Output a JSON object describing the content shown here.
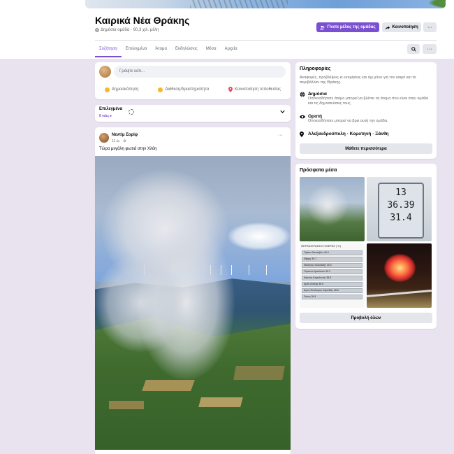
{
  "group": {
    "title": "Καιρικά Νέα Θράκης",
    "meta": "Δημόσια ομάδα · 60,3 χιλ. μέλη",
    "join_label": "Γίνετε μέλος της ομάδας",
    "share_label": "Κοινοποίηση",
    "more_label": "···"
  },
  "tabs": [
    "Συζήτηση",
    "Επιλεγμένα",
    "Άτομα",
    "Εκδηλώσεις",
    "Μέσα",
    "Αρχεία"
  ],
  "composer": {
    "placeholder": "Γράψτε κάτι...",
    "actions": [
      "Δημοσκόπηση",
      "Διάθεση/δραστηριότητα",
      "Κοινοποίηση τοποθεσίας"
    ]
  },
  "filter": {
    "label": "Επιλεγμένα",
    "sub": "6 νέες ▸"
  },
  "post": {
    "author": "Νεντίμ Σορίφ",
    "time": "11 ώ. · ⚙",
    "text": "Τώρα μεγάλη φωτιά στην Χλόη",
    "more": "···"
  },
  "info": {
    "heading": "Πληροφορίες",
    "description": "Αναφορές, προβλέψεις κι εκτιμήσεις και όχι μόνο για τον καιρό και το περιβάλλον της Θράκης.",
    "public_title": "Δημόσια",
    "public_desc": "Οποιοσδήποτε άτομο μπορεί να βλέπει τα άτομα που είναι στην ομάδα και τις δημοσιεύσεις τους.",
    "visible_title": "Ορατή",
    "visible_desc": "Οποιοσδήποτε μπορεί να βρει αυτή την ομάδα.",
    "location": "Αλεξανδρούπολη · Κομοτηνή · Ξάνθη",
    "learn_more": "Μάθετε περισσότερα"
  },
  "media": {
    "heading": "Πρόσφατα μέσα",
    "see_all": "Προβολή όλων",
    "thermometer_lines": [
      "13",
      "36.39",
      "31.4"
    ],
    "table_title": "ΘΕΡΜΟΚΡΑΣΙΕΣ ΗΜΕΡΑΣ (°C)",
    "table_rows": [
      "Ορέσιο Μετσόβου   40.4",
      "Θέρμη   39.7",
      "Μαστρος Χαλκιδικής   39.3",
      "Γόρτυνα Ηρακλείου   39.1",
      "Κάμπος Κεφαλονιάς   38.8",
      "Άρδα Αττικής   38.6",
      "Άγιος Θεόδωρος Κορινθίας   38.6",
      "Σάκος   38.4"
    ]
  },
  "colors": {
    "accent": "#7a4fd1",
    "page_bg": "#e9e3ef"
  }
}
